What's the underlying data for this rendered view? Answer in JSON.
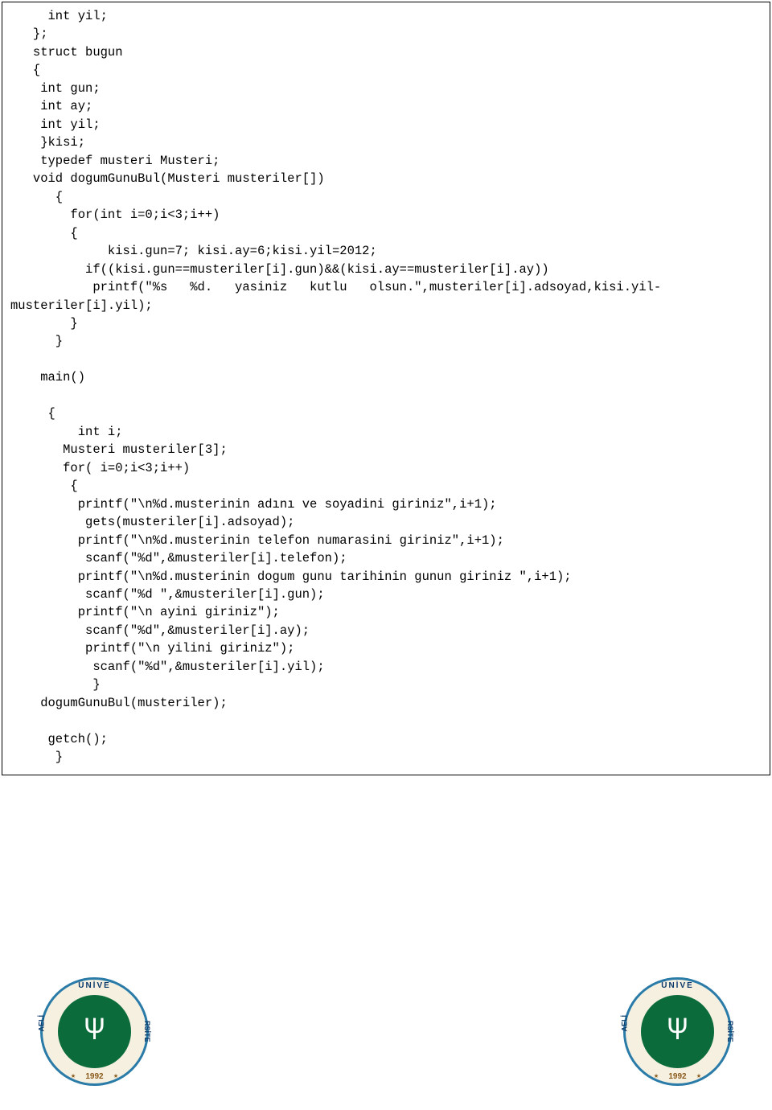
{
  "code": {
    "lines": [
      "     int yil;",
      "   };",
      "   struct bugun",
      "   {",
      "    int gun;",
      "    int ay;",
      "    int yil;",
      "    }kisi;",
      "    typedef musteri Musteri;",
      "   void dogumGunuBul(Musteri musteriler[])",
      "      {",
      "        for(int i=0;i<3;i++)",
      "        {",
      "             kisi.gun=7; kisi.ay=6;kisi.yil=2012;",
      "          if((kisi.gun==musteriler[i].gun)&&(kisi.ay==musteriler[i].ay))",
      "           printf(\"%s   %d.   yasiniz   kutlu   olsun.\",musteriler[i].adsoyad,kisi.yil-",
      "musteriler[i].yil);",
      "        }",
      "      }",
      "",
      "    main()",
      "",
      "     {",
      "         int i;",
      "       Musteri musteriler[3];",
      "       for( i=0;i<3;i++)",
      "        {",
      "         printf(\"\\n%d.musterinin adını ve soyadini giriniz\",i+1);",
      "          gets(musteriler[i].adsoyad);",
      "         printf(\"\\n%d.musterinin telefon numarasini giriniz\",i+1);",
      "          scanf(\"%d\",&musteriler[i].telefon);",
      "         printf(\"\\n%d.musterinin dogum gunu tarihinin gunun giriniz \",i+1);",
      "          scanf(\"%d \",&musteriler[i].gun);",
      "         printf(\"\\n ayini giriniz\");",
      "          scanf(\"%d\",&musteriler[i].ay);",
      "          printf(\"\\n yilini giriniz\");",
      "           scanf(\"%d\",&musteriler[i].yil);",
      "           }",
      "    dogumGunuBul(musteriler);",
      "",
      "     getch();",
      "      }"
    ]
  },
  "logo": {
    "top_text": "ÜNİVE",
    "left_text": "AELİ",
    "right_text": "RSİTE",
    "year": "1992",
    "star": "★",
    "trident": "Ψ"
  }
}
